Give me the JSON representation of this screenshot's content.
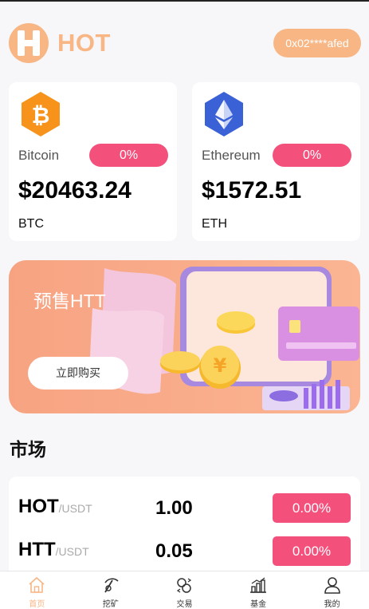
{
  "header": {
    "logo_letter": "H",
    "brand": "HOT",
    "wallet_address": "0x02****afed"
  },
  "coins": [
    {
      "name": "Bitcoin",
      "change": "0%",
      "price": "$20463.24",
      "symbol": "BTC",
      "icon": "bitcoin-icon",
      "color": "#f7931a"
    },
    {
      "name": "Ethereum",
      "change": "0%",
      "price": "$1572.51",
      "symbol": "ETH",
      "icon": "ethereum-icon",
      "color": "#3b61d6"
    }
  ],
  "banner": {
    "title": "预售HTT",
    "button_label": "立即购买"
  },
  "market": {
    "title": "市场",
    "rows": [
      {
        "name": "HOT",
        "quote": "/USDT",
        "price": "1.00",
        "change": "0.00%"
      },
      {
        "name": "HTT",
        "quote": "/USDT",
        "price": "0.05",
        "change": "0.00%"
      }
    ]
  },
  "tabs": [
    {
      "label": "首页",
      "icon": "home-icon",
      "active": true
    },
    {
      "label": "挖矿",
      "icon": "pickaxe-icon",
      "active": false
    },
    {
      "label": "交易",
      "icon": "exchange-icon",
      "active": false
    },
    {
      "label": "基金",
      "icon": "chart-icon",
      "active": false
    },
    {
      "label": "我的",
      "icon": "user-icon",
      "active": false
    }
  ],
  "colors": {
    "accent": "#f8b684",
    "badge": "#f4507c",
    "bitcoin": "#f7931a",
    "ethereum": "#3b61d6"
  }
}
